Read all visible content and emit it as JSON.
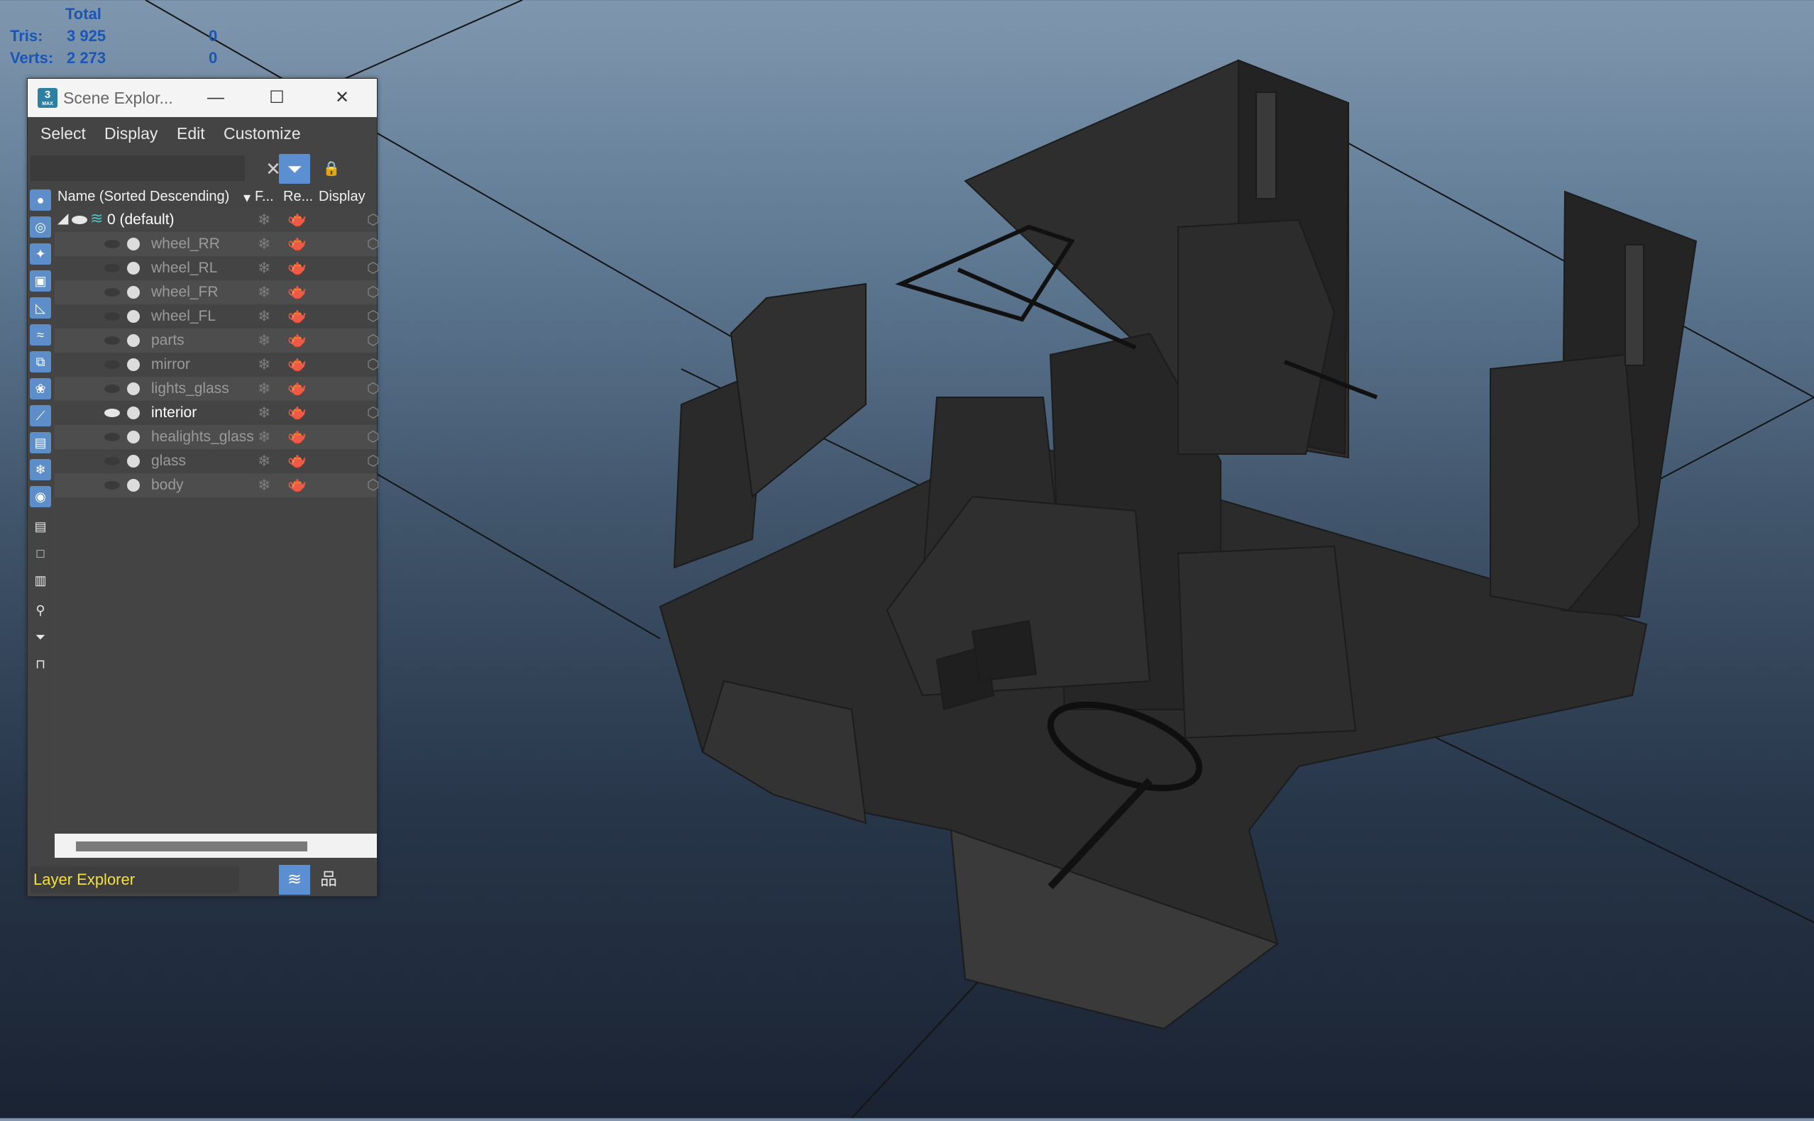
{
  "stats": {
    "header": "Total",
    "rows": [
      {
        "label": "Tris:",
        "total": "3 925",
        "selected": "0"
      },
      {
        "label": "Verts:",
        "total": "2 273",
        "selected": "0"
      }
    ]
  },
  "window": {
    "title": "Scene Explor...",
    "app_icon_text": "3",
    "app_icon_sub": "MAX",
    "minimize": "—",
    "maximize": "☐",
    "close": "✕"
  },
  "menu": [
    "Select",
    "Display",
    "Edit",
    "Customize"
  ],
  "toolbar": {
    "search_value": "",
    "clear_icon": "✕",
    "filter_icon": "⏷",
    "lock_icon": "🔒"
  },
  "columns": {
    "name": "Name (Sorted Descending)",
    "sort_arrow": "▾",
    "freeze": "F...",
    "render": "Re...",
    "display": "Display"
  },
  "layers": {
    "root": {
      "name": "0 (default)"
    },
    "items": [
      {
        "name": "wheel_RR",
        "visible": false
      },
      {
        "name": "wheel_RL",
        "visible": false
      },
      {
        "name": "wheel_FR",
        "visible": false
      },
      {
        "name": "wheel_FL",
        "visible": false
      },
      {
        "name": "parts",
        "visible": false
      },
      {
        "name": "mirror",
        "visible": false
      },
      {
        "name": "lights_glass",
        "visible": false
      },
      {
        "name": "interior",
        "visible": true
      },
      {
        "name": "healights_glass",
        "visible": false
      },
      {
        "name": "glass",
        "visible": false
      },
      {
        "name": "body",
        "visible": false
      }
    ]
  },
  "glyphs": {
    "freeze": "❄",
    "render": "🫖",
    "display": "⬡",
    "eye": "👁"
  },
  "footer": {
    "explorer_name": "Layer Explorer",
    "layers_icon": "≋",
    "hierarchy_icon": "品"
  },
  "colors": {
    "stats_text": "#1a55b8",
    "accent": "#5b8fd2",
    "layer_name_text": "#f4e13a"
  }
}
